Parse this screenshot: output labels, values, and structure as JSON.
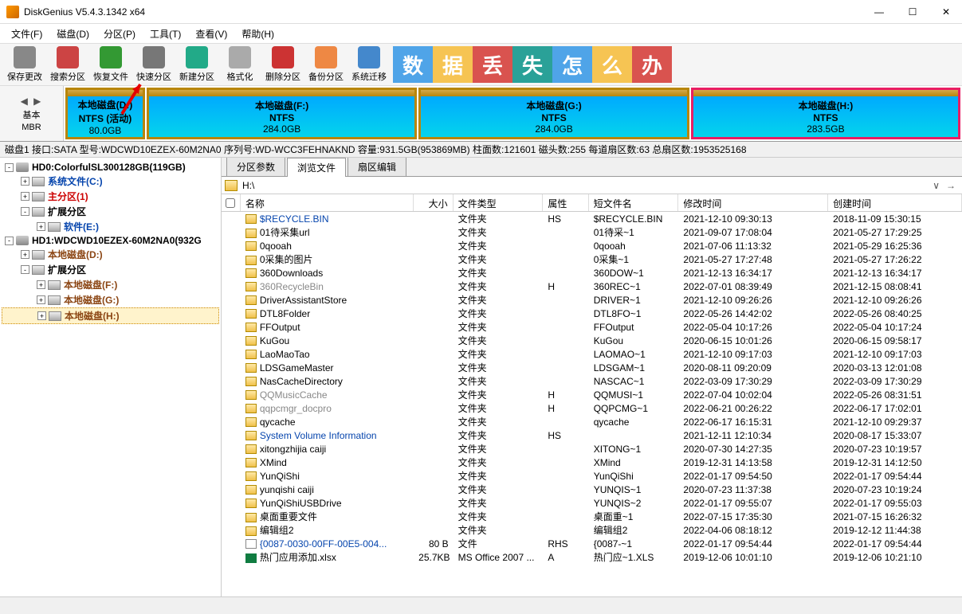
{
  "title": "DiskGenius V5.4.3.1342 x64",
  "menu": [
    "文件(F)",
    "磁盘(D)",
    "分区(P)",
    "工具(T)",
    "查看(V)",
    "帮助(H)"
  ],
  "toolbar": [
    {
      "label": "保存更改",
      "color": "#888"
    },
    {
      "label": "搜索分区",
      "color": "#c44"
    },
    {
      "label": "恢复文件",
      "color": "#393"
    },
    {
      "label": "快速分区",
      "color": "#777"
    },
    {
      "label": "新建分区",
      "color": "#2a8"
    },
    {
      "label": "格式化",
      "color": "#aaa"
    },
    {
      "label": "删除分区",
      "color": "#c33"
    },
    {
      "label": "备份分区",
      "color": "#e84"
    },
    {
      "label": "系统迁移",
      "color": "#48c"
    }
  ],
  "banner": [
    {
      "bg": "#4fa4e8",
      "txt": "数"
    },
    {
      "bg": "#f6c453",
      "txt": "据"
    },
    {
      "bg": "#d9534f",
      "txt": "丢"
    },
    {
      "bg": "#2aa198",
      "txt": "失"
    },
    {
      "bg": "#4fa4e8",
      "txt": "怎"
    },
    {
      "bg": "#f6c453",
      "txt": "么"
    },
    {
      "bg": "#d9534f",
      "txt": "办"
    }
  ],
  "mbr": {
    "arrows": "◀ ▶",
    "l1": "基本",
    "l2": "MBR"
  },
  "partitions": [
    {
      "name": "本地磁盘(D:)",
      "fs": "NTFS (活动)",
      "size": "80.0GB",
      "flex": 80,
      "used": 70,
      "sel": false
    },
    {
      "name": "本地磁盘(F:)",
      "fs": "NTFS",
      "size": "284.0GB",
      "flex": 284,
      "used": 3,
      "sel": false
    },
    {
      "name": "本地磁盘(G:)",
      "fs": "NTFS",
      "size": "284.0GB",
      "flex": 284,
      "used": 4,
      "sel": false
    },
    {
      "name": "本地磁盘(H:)",
      "fs": "NTFS",
      "size": "283.5GB",
      "flex": 283,
      "used": 8,
      "sel": true
    }
  ],
  "diskinfo": "磁盘1 接口:SATA 型号:WDCWD10EZEX-60M2NA0 序列号:WD-WCC3FEHNAKND 容量:931.5GB(953869MB) 柱面数:121601 磁头数:255 每道扇区数:63 总扇区数:1953525168",
  "tree": [
    {
      "ind": 0,
      "exp": "-",
      "ico": "disk",
      "txt": "HD0:ColorfulSL300128GB(119GB)",
      "cls": "bold-black"
    },
    {
      "ind": 1,
      "exp": "+",
      "ico": "drive",
      "txt": "系统文件(C:)",
      "cls": "bold-blue"
    },
    {
      "ind": 1,
      "exp": "+",
      "ico": "drive",
      "txt": "主分区(1)",
      "cls": "bold-red"
    },
    {
      "ind": 1,
      "exp": "-",
      "ico": "drive",
      "txt": "扩展分区",
      "cls": "bold-black"
    },
    {
      "ind": 2,
      "exp": "+",
      "ico": "drive",
      "txt": "软件(E:)",
      "cls": "bold-blue"
    },
    {
      "ind": 0,
      "exp": "-",
      "ico": "disk",
      "txt": "HD1:WDCWD10EZEX-60M2NA0(932G",
      "cls": "bold-black"
    },
    {
      "ind": 1,
      "exp": "+",
      "ico": "drive",
      "txt": "本地磁盘(D:)",
      "cls": "norm-brown"
    },
    {
      "ind": 1,
      "exp": "-",
      "ico": "drive",
      "txt": "扩展分区",
      "cls": "bold-black"
    },
    {
      "ind": 2,
      "exp": "+",
      "ico": "drive",
      "txt": "本地磁盘(F:)",
      "cls": "norm-brown"
    },
    {
      "ind": 2,
      "exp": "+",
      "ico": "drive",
      "txt": "本地磁盘(G:)",
      "cls": "norm-brown"
    },
    {
      "ind": 2,
      "exp": "+",
      "ico": "drive",
      "txt": "本地磁盘(H:)",
      "cls": "norm-brown",
      "sel": true
    }
  ],
  "tabs": [
    "分区参数",
    "浏览文件",
    "扇区编辑"
  ],
  "active_tab": 1,
  "path": "H:\\",
  "cols": {
    "name": "名称",
    "size": "大小",
    "type": "文件类型",
    "attr": "属性",
    "short": "短文件名",
    "mtime": "修改时间",
    "ctime": "创建时间"
  },
  "files": [
    {
      "n": "$RECYCLE.BIN",
      "sz": "",
      "t": "文件夹",
      "a": "HS",
      "s": "$RECYCLE.BIN",
      "m": "2021-12-10 09:30:13",
      "c": "2018-11-09 15:30:15",
      "ico": "folder",
      "cls": "blue-txt"
    },
    {
      "n": "01待采集url",
      "sz": "",
      "t": "文件夹",
      "a": "",
      "s": "01待采~1",
      "m": "2021-09-07 17:08:04",
      "c": "2021-05-27 17:29:25",
      "ico": "folder"
    },
    {
      "n": "0qooah",
      "sz": "",
      "t": "文件夹",
      "a": "",
      "s": "0qooah",
      "m": "2021-07-06 11:13:32",
      "c": "2021-05-29 16:25:36",
      "ico": "folder"
    },
    {
      "n": "0采集的图片",
      "sz": "",
      "t": "文件夹",
      "a": "",
      "s": "0采集~1",
      "m": "2021-05-27 17:27:48",
      "c": "2021-05-27 17:26:22",
      "ico": "folder"
    },
    {
      "n": "360Downloads",
      "sz": "",
      "t": "文件夹",
      "a": "",
      "s": "360DOW~1",
      "m": "2021-12-13 16:34:17",
      "c": "2021-12-13 16:34:17",
      "ico": "folder"
    },
    {
      "n": "360RecycleBin",
      "sz": "",
      "t": "文件夹",
      "a": "H",
      "s": "360REC~1",
      "m": "2022-07-01 08:39:49",
      "c": "2021-12-15 08:08:41",
      "ico": "folder",
      "cls": "gray-txt"
    },
    {
      "n": "DriverAssistantStore",
      "sz": "",
      "t": "文件夹",
      "a": "",
      "s": "DRIVER~1",
      "m": "2021-12-10 09:26:26",
      "c": "2021-12-10 09:26:26",
      "ico": "folder"
    },
    {
      "n": "DTL8Folder",
      "sz": "",
      "t": "文件夹",
      "a": "",
      "s": "DTL8FO~1",
      "m": "2022-05-26 14:42:02",
      "c": "2022-05-26 08:40:25",
      "ico": "folder"
    },
    {
      "n": "FFOutput",
      "sz": "",
      "t": "文件夹",
      "a": "",
      "s": "FFOutput",
      "m": "2022-05-04 10:17:26",
      "c": "2022-05-04 10:17:24",
      "ico": "folder"
    },
    {
      "n": "KuGou",
      "sz": "",
      "t": "文件夹",
      "a": "",
      "s": "KuGou",
      "m": "2020-06-15 10:01:26",
      "c": "2020-06-15 09:58:17",
      "ico": "folder"
    },
    {
      "n": "LaoMaoTao",
      "sz": "",
      "t": "文件夹",
      "a": "",
      "s": "LAOMAO~1",
      "m": "2021-12-10 09:17:03",
      "c": "2021-12-10 09:17:03",
      "ico": "folder"
    },
    {
      "n": "LDSGameMaster",
      "sz": "",
      "t": "文件夹",
      "a": "",
      "s": "LDSGAM~1",
      "m": "2020-08-11 09:20:09",
      "c": "2020-03-13 12:01:08",
      "ico": "folder"
    },
    {
      "n": "NasCacheDirectory",
      "sz": "",
      "t": "文件夹",
      "a": "",
      "s": "NASCAC~1",
      "m": "2022-03-09 17:30:29",
      "c": "2022-03-09 17:30:29",
      "ico": "folder"
    },
    {
      "n": "QQMusicCache",
      "sz": "",
      "t": "文件夹",
      "a": "H",
      "s": "QQMUSI~1",
      "m": "2022-07-04 10:02:04",
      "c": "2022-05-26 08:31:51",
      "ico": "folder",
      "cls": "gray-txt"
    },
    {
      "n": "qqpcmgr_docpro",
      "sz": "",
      "t": "文件夹",
      "a": "H",
      "s": "QQPCMG~1",
      "m": "2022-06-21 00:26:22",
      "c": "2022-06-17 17:02:01",
      "ico": "folder",
      "cls": "gray-txt"
    },
    {
      "n": "qycache",
      "sz": "",
      "t": "文件夹",
      "a": "",
      "s": "qycache",
      "m": "2022-06-17 16:15:31",
      "c": "2021-12-10 09:29:37",
      "ico": "folder"
    },
    {
      "n": "System Volume Information",
      "sz": "",
      "t": "文件夹",
      "a": "HS",
      "s": "",
      "m": "2021-12-11 12:10:34",
      "c": "2020-08-17 15:33:07",
      "ico": "folder",
      "cls": "blue-txt"
    },
    {
      "n": "xitongzhijia caiji",
      "sz": "",
      "t": "文件夹",
      "a": "",
      "s": "XITONG~1",
      "m": "2020-07-30 14:27:35",
      "c": "2020-07-23 10:19:57",
      "ico": "folder"
    },
    {
      "n": "XMind",
      "sz": "",
      "t": "文件夹",
      "a": "",
      "s": "XMind",
      "m": "2019-12-31 14:13:58",
      "c": "2019-12-31 14:12:50",
      "ico": "folder"
    },
    {
      "n": "YunQiShi",
      "sz": "",
      "t": "文件夹",
      "a": "",
      "s": "YunQiShi",
      "m": "2022-01-17 09:54:50",
      "c": "2022-01-17 09:54:44",
      "ico": "folder"
    },
    {
      "n": "yunqishi caiji",
      "sz": "",
      "t": "文件夹",
      "a": "",
      "s": "YUNQIS~1",
      "m": "2020-07-23 11:37:38",
      "c": "2020-07-23 10:19:24",
      "ico": "folder"
    },
    {
      "n": "YunQiShiUSBDrive",
      "sz": "",
      "t": "文件夹",
      "a": "",
      "s": "YUNQIS~2",
      "m": "2022-01-17 09:55:07",
      "c": "2022-01-17 09:55:03",
      "ico": "folder"
    },
    {
      "n": "桌面重要文件",
      "sz": "",
      "t": "文件夹",
      "a": "",
      "s": "桌面重~1",
      "m": "2022-07-15 17:35:30",
      "c": "2021-07-15 16:26:32",
      "ico": "folder"
    },
    {
      "n": "编辑组2",
      "sz": "",
      "t": "文件夹",
      "a": "",
      "s": "编辑组2",
      "m": "2022-04-06 08:18:12",
      "c": "2019-12-12 11:44:38",
      "ico": "folder"
    },
    {
      "n": "{0087-0030-00FF-00E5-004...",
      "sz": "80 B",
      "t": "文件",
      "a": "RHS",
      "s": "{0087-~1",
      "m": "2022-01-17 09:54:44",
      "c": "2022-01-17 09:54:44",
      "ico": "file",
      "cls": "blue-txt"
    },
    {
      "n": "热门应用添加.xlsx",
      "sz": "25.7KB",
      "t": "MS Office 2007 ...",
      "a": "A",
      "s": "热门应~1.XLS",
      "m": "2019-12-06 10:01:10",
      "c": "2019-12-06 10:21:10",
      "ico": "xlsx"
    }
  ]
}
